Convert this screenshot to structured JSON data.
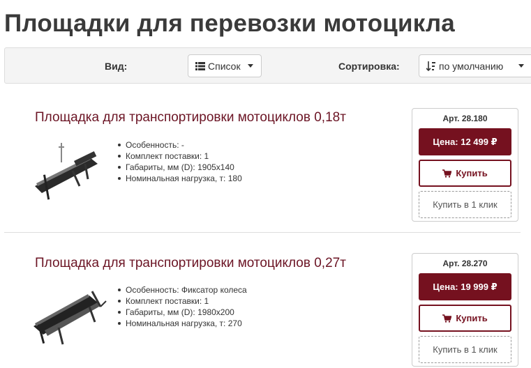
{
  "page": {
    "title": "Площадки для перевозки мотоцикла"
  },
  "toolbar": {
    "view_label": "Вид:",
    "view_value": "Список",
    "view_icon": "list-icon",
    "sort_label": "Сортировка:",
    "sort_value": "по умолчанию",
    "sort_icon": "sort-icon"
  },
  "products": [
    {
      "title": "Площадка для транспортировки мотоциклов 0,18т",
      "specs": [
        "Особенность: -",
        "Комплект поставки: 1",
        "Габариты, мм (D): 1905х140",
        "Номинальная нагрузка, т: 180"
      ],
      "article": "Арт. 28.180",
      "price": "Цена: 12 499 ₽",
      "buy_label": "Купить",
      "oneclick_label": "Купить в 1 клик"
    },
    {
      "title": "Площадка для транспортировки мотоциклов 0,27т",
      "specs": [
        "Особенность: Фиксатор колеса",
        "Комплект поставки: 1",
        "Габариты, мм (D): 1980х200",
        "Номинальная нагрузка, т: 270"
      ],
      "article": "Арт. 28.270",
      "price": "Цена: 19 999 ₽",
      "buy_label": "Купить",
      "oneclick_label": "Купить в 1 клик"
    }
  ],
  "colors": {
    "brand": "#75111f",
    "title": "#6b1424",
    "toolbar_bg": "#f4f4f4"
  }
}
